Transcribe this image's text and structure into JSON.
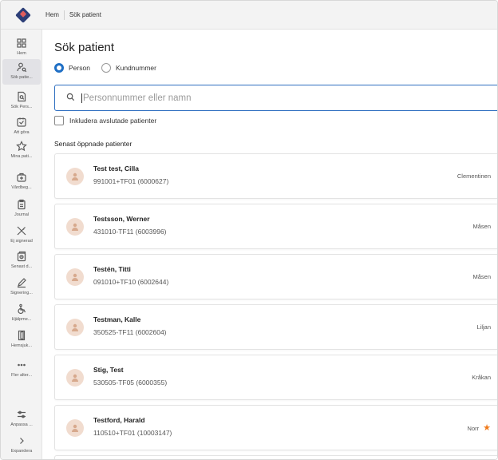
{
  "breadcrumb": [
    "Hem",
    "Sök patient"
  ],
  "sidebar": {
    "items": [
      {
        "label": "Hem",
        "icon": "grid-icon",
        "active": false
      },
      {
        "label": "Sök patie...",
        "icon": "person-search-icon",
        "active": true
      },
      {
        "label": "Sök Pers...",
        "icon": "document-search-icon",
        "active": false
      },
      {
        "label": "Att göra",
        "icon": "checkbox-icon",
        "active": false
      },
      {
        "label": "Mina pati...",
        "icon": "star-icon",
        "active": false
      },
      {
        "label": "Vårdbeg...",
        "icon": "medical-bag-icon",
        "active": false
      },
      {
        "label": "Journal",
        "icon": "clipboard-icon",
        "active": false
      },
      {
        "label": "Ej signerad",
        "icon": "unsigned-icon",
        "active": false
      },
      {
        "label": "Senast d...",
        "icon": "recent-docs-icon",
        "active": false
      },
      {
        "label": "Signering...",
        "icon": "pen-icon",
        "active": false
      },
      {
        "label": "Hjälpme...",
        "icon": "wheelchair-icon",
        "active": false
      },
      {
        "label": "Hemsjuk...",
        "icon": "door-icon",
        "active": false
      },
      {
        "label": "Fler alter...",
        "icon": "more-icon",
        "active": false
      }
    ],
    "bottom": [
      {
        "label": "Anpassa ...",
        "icon": "sliders-icon"
      },
      {
        "label": "Expandera",
        "icon": "chevron-right-icon"
      }
    ]
  },
  "main": {
    "title": "Sök patient",
    "radio": {
      "person": "Person",
      "customer": "Kundnummer",
      "selected": "Person"
    },
    "search_placeholder": "Personnummer eller namn",
    "include_closed_label": "Inkludera avslutade patienter",
    "recent_title": "Senast öppnade patienter",
    "patients": [
      {
        "name": "Test test, Cilla",
        "id": "991001+TF01 (6000627)",
        "unit": "Clementinen",
        "favorite": false
      },
      {
        "name": "Testsson, Werner",
        "id": "431010-TF11 (6003996)",
        "unit": "Måsen",
        "favorite": false
      },
      {
        "name": "Testén, Titti",
        "id": "091010+TF10 (6002644)",
        "unit": "Måsen",
        "favorite": false
      },
      {
        "name": "Testman, Kalle",
        "id": "350525-TF11 (6002604)",
        "unit": "Liljan",
        "favorite": false
      },
      {
        "name": "Stig, Test",
        "id": "530505-TF05 (6000355)",
        "unit": "Kråkan",
        "favorite": false
      },
      {
        "name": "Testford, Harald",
        "id": "110510+TF01 (10003147)",
        "unit": "Norr",
        "favorite": true
      }
    ]
  },
  "colors": {
    "accent": "#1f6fc5",
    "star": "#f07a1a",
    "avatar_bg": "#f1dccf"
  }
}
